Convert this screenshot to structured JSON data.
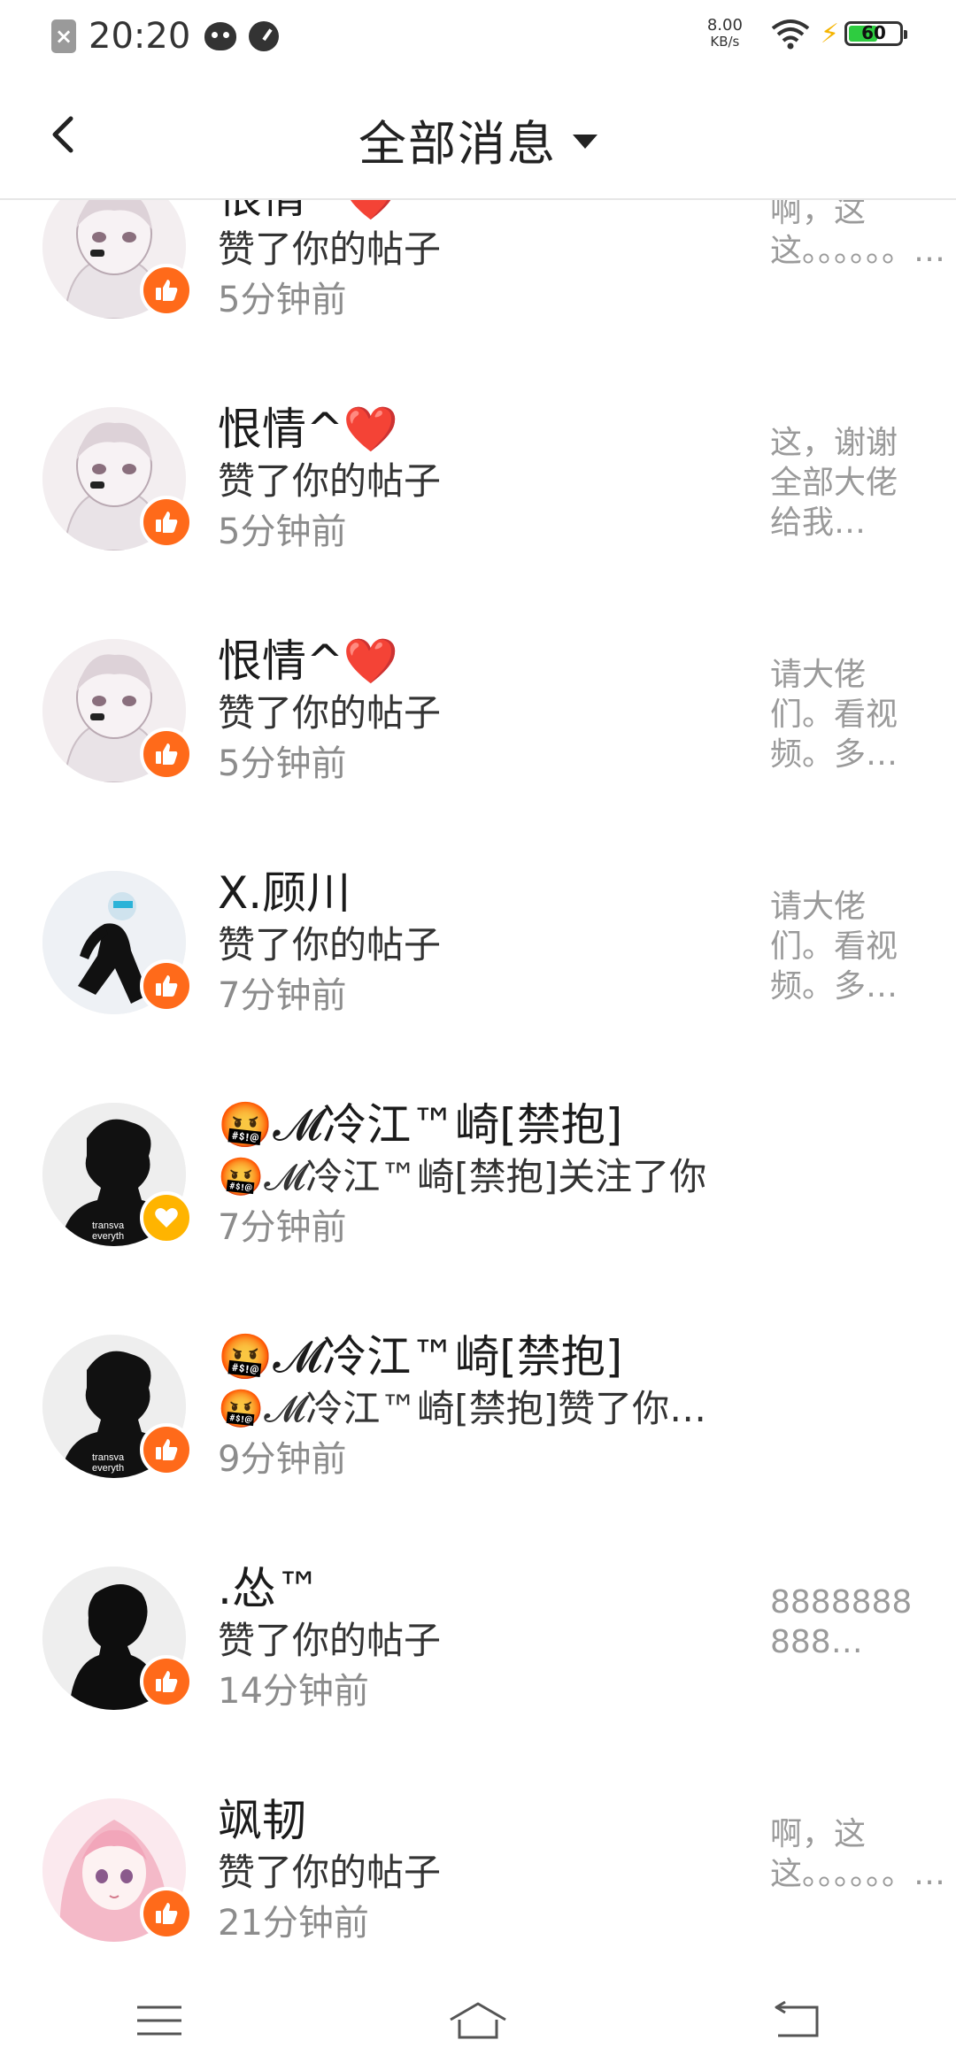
{
  "status_bar": {
    "time": "20:20",
    "net_speed": "8.00",
    "net_speed_unit": "KB/s",
    "battery": "60",
    "battery_level": 0.6
  },
  "header": {
    "title": "全部消息"
  },
  "notifications": [
    {
      "name": "恨情^❤️",
      "action": "赞了你的帖子",
      "time": "5分钟前",
      "preview": "啊，这这。。。。。。…",
      "badge": "like",
      "avatar": "anime-girl"
    },
    {
      "name": "恨情^❤️",
      "action": "赞了你的帖子",
      "time": "5分钟前",
      "preview": "这，谢谢全部大佬给我…",
      "badge": "like",
      "avatar": "anime-girl"
    },
    {
      "name": "恨情^❤️",
      "action": "赞了你的帖子",
      "time": "5分钟前",
      "preview": "请大佬们。看视频。多…",
      "badge": "like",
      "avatar": "anime-girl"
    },
    {
      "name": "X.顾川",
      "action": "赞了你的帖子",
      "time": "7分钟前",
      "preview": "请大佬们。看视频。多…",
      "badge": "like",
      "avatar": "sitting-figure"
    },
    {
      "name": "🤬𝓜冷江™崎[禁抱]",
      "action": "🤬𝓜冷江™崎[禁抱]关注了你",
      "time": "7分钟前",
      "preview": "",
      "badge": "heart",
      "avatar": "silhouette"
    },
    {
      "name": "🤬𝓜冷江™崎[禁抱]",
      "action": "🤬𝓜冷江™崎[禁抱]赞了你…",
      "time": "9分钟前",
      "preview": "",
      "badge": "like",
      "avatar": "silhouette"
    },
    {
      "name": ".怂™",
      "action": "赞了你的帖子",
      "time": "14分钟前",
      "preview": "8888888888…",
      "badge": "like",
      "avatar": "dark-figure"
    },
    {
      "name": "飒韧",
      "action": "赞了你的帖子",
      "time": "21分钟前",
      "preview": "啊，这这。。。。。。…",
      "badge": "like",
      "avatar": "pink-girl"
    }
  ],
  "nav_bar": {
    "items": [
      "menu-icon",
      "home-icon",
      "back-nav-icon"
    ]
  }
}
